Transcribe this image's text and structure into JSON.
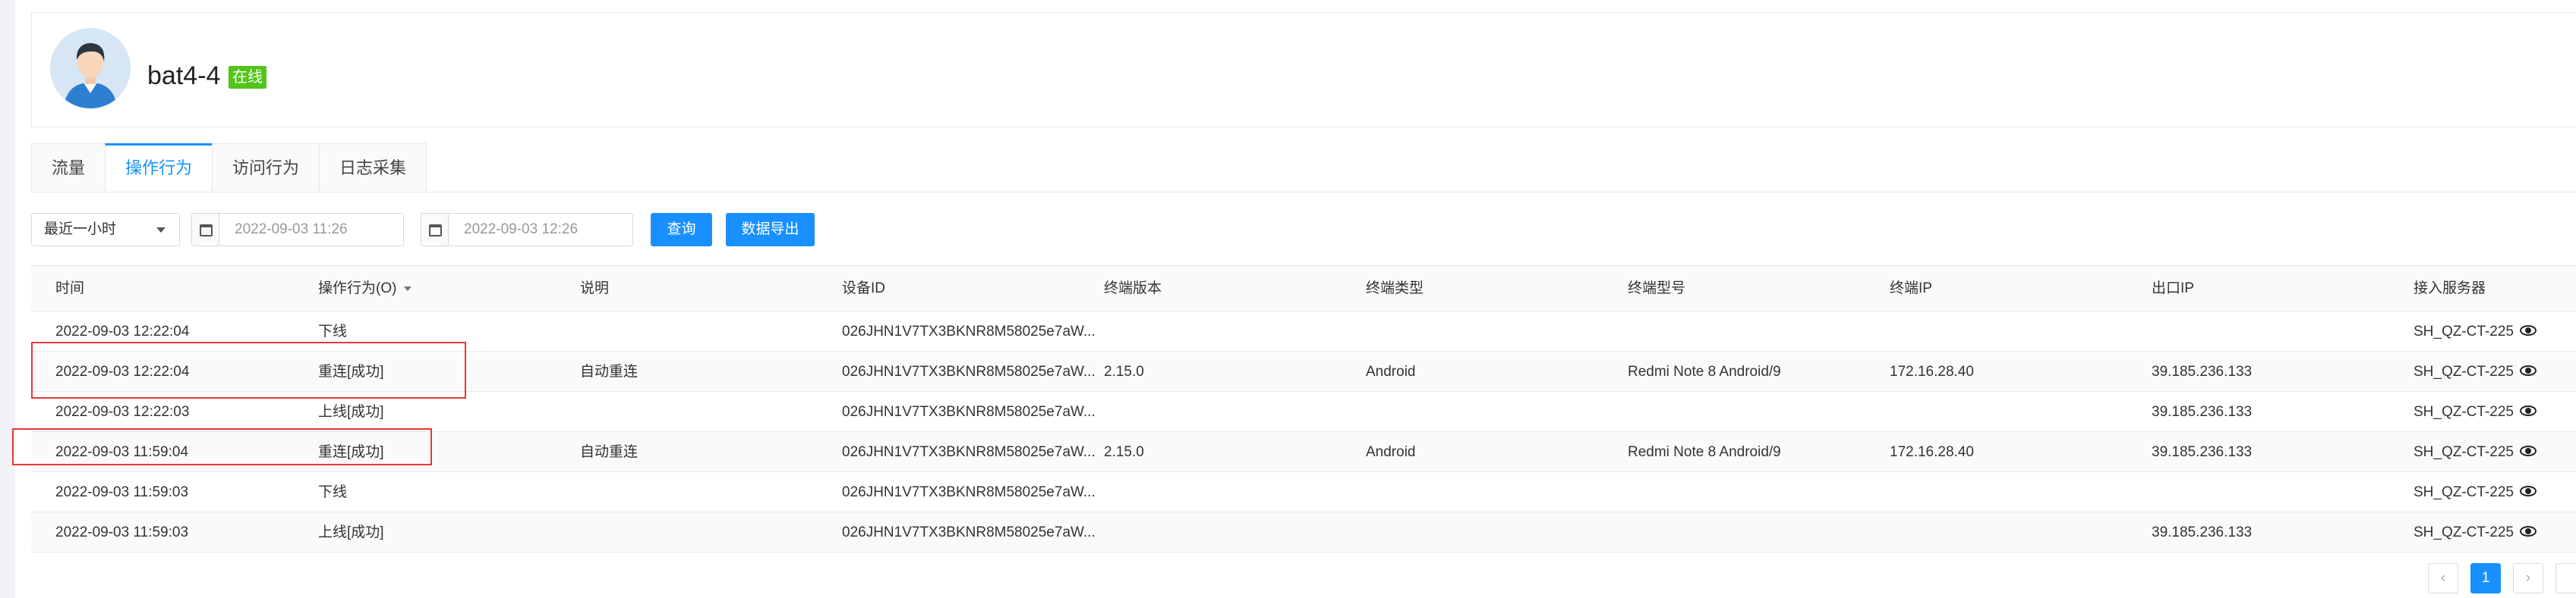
{
  "device": {
    "name": "bat4-4",
    "status": "在线"
  },
  "tabs": [
    {
      "label": "流量"
    },
    {
      "label": "操作行为"
    },
    {
      "label": "访问行为"
    },
    {
      "label": "日志采集"
    }
  ],
  "filters": {
    "range": "最近一小时",
    "start": "2022-09-03 11:26",
    "end": "2022-09-03 12:26",
    "query_label": "查询",
    "export_label": "数据导出"
  },
  "columns": [
    "时间",
    "操作行为(O)",
    "说明",
    "设备ID",
    "终端版本",
    "终端类型",
    "终端型号",
    "终端IP",
    "出口IP",
    "接入服务器"
  ],
  "rows": [
    {
      "time": "2022-09-03 12:22:04",
      "action": "下线",
      "desc": "",
      "device_id": "026JHN1V7TX3BKNR8M58025e7aW...",
      "version": "",
      "type": "",
      "model": "",
      "ip": "",
      "exit_ip": "",
      "server": "SH_QZ-CT-225"
    },
    {
      "time": "2022-09-03 12:22:04",
      "action": "重连[成功]",
      "desc": "自动重连",
      "device_id": "026JHN1V7TX3BKNR8M58025e7aW...",
      "version": "2.15.0",
      "type": "Android",
      "model": "Redmi Note 8 Android/9",
      "ip": "172.16.28.40",
      "exit_ip": "39.185.236.133",
      "server": "SH_QZ-CT-225"
    },
    {
      "time": "2022-09-03 12:22:03",
      "action": "上线[成功]",
      "desc": "",
      "device_id": "026JHN1V7TX3BKNR8M58025e7aW...",
      "version": "",
      "type": "",
      "model": "",
      "ip": "",
      "exit_ip": "39.185.236.133",
      "server": "SH_QZ-CT-225"
    },
    {
      "time": "2022-09-03 11:59:04",
      "action": "重连[成功]",
      "desc": "自动重连",
      "device_id": "026JHN1V7TX3BKNR8M58025e7aW...",
      "version": "2.15.0",
      "type": "Android",
      "model": "Redmi Note 8 Android/9",
      "ip": "172.16.28.40",
      "exit_ip": "39.185.236.133",
      "server": "SH_QZ-CT-225"
    },
    {
      "time": "2022-09-03 11:59:03",
      "action": "下线",
      "desc": "",
      "device_id": "026JHN1V7TX3BKNR8M58025e7aW...",
      "version": "",
      "type": "",
      "model": "",
      "ip": "",
      "exit_ip": "",
      "server": "SH_QZ-CT-225"
    },
    {
      "time": "2022-09-03 11:59:03",
      "action": "上线[成功]",
      "desc": "",
      "device_id": "026JHN1V7TX3BKNR8M58025e7aW...",
      "version": "",
      "type": "",
      "model": "",
      "ip": "",
      "exit_ip": "39.185.236.133",
      "server": "SH_QZ-CT-225"
    }
  ],
  "pagination": {
    "prev": "‹",
    "page": "1",
    "next": "›"
  },
  "colors": {
    "accent": "#1890ff",
    "online": "#52c41a",
    "highlight": "#e53935"
  },
  "icons": [
    "avatar",
    "calendar-icon",
    "eye-icon",
    "chevron-left-icon",
    "chevron-right-icon"
  ]
}
